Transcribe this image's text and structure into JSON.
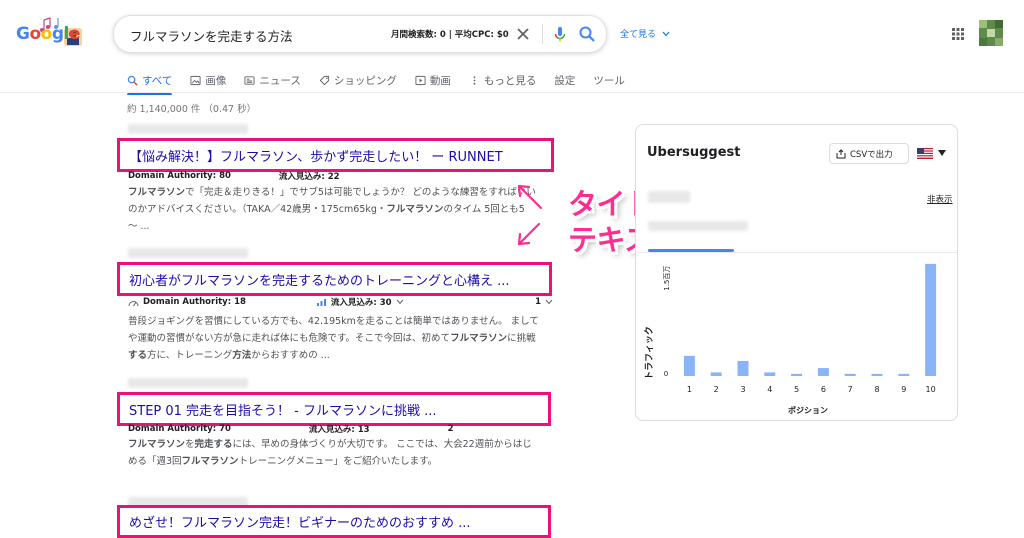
{
  "search": {
    "query": "フルマラソンを完走する方法",
    "stats": "月間検索数: 0 | 平均CPC: $0",
    "see_all": "全て見る"
  },
  "tabs": [
    {
      "label": "すべて",
      "icon": "search-icon",
      "active": true
    },
    {
      "label": "画像",
      "icon": "image-icon"
    },
    {
      "label": "ニュース",
      "icon": "news-icon"
    },
    {
      "label": "ショッピング",
      "icon": "tag-icon"
    },
    {
      "label": "動画",
      "icon": "play-icon"
    },
    {
      "label": "もっと見る",
      "icon": "more-vert-icon"
    },
    {
      "label": "設定"
    },
    {
      "label": "ツール"
    }
  ],
  "result_count": "約 1,140,000 件 （0.47 秒）",
  "results": [
    {
      "title": "【悩み解決！】フルマラソン、歩かず完走したい！ ー RUNNET",
      "meta_da": "Domain Authority: 80",
      "meta_traffic": "流入見込み: 22",
      "snippet_html": "<b>フルマラソン</b>で「完走＆走りきる！」でサブ5は可能でしょうか？ どのような練習をすればいい<br>のかアドバイスください。（TAKA／42歳男・175cm65kg・<b>フルマラソン</b>のタイム 5回とも5<br>〜 ..."
    },
    {
      "title": "初心者がフルマラソンを完走するためのトレーニングと心構え ...",
      "meta_da": "Domain Authority: 18",
      "meta_traffic": "流入見込み: 30",
      "meta_count": "1",
      "snippet_html": "普段ジョギングを習慣にしている方でも、42.195kmを走ることは簡単ではありません。 まして<br>や運動の習慣がない方が急に走れば体にも危険です。そこで今回は、初めて<b>フルマラソン</b>に挑戦<br><b>する</b>方に、トレーニング<b>方法</b>からおすすめの ..."
    },
    {
      "title": "STEP 01 完走を目指そう！ - フルマラソンに挑戦 ...",
      "meta_da": "Domain Authority: 70",
      "meta_traffic": "流入見込み: 13",
      "meta_count": "2",
      "snippet_html": "<b>フルマラソン</b>を<b>完走する</b>には、早めの身体づくりが大切です。 ここでは、大会22週前からはじ<br>める「週3回<b>フルマラソン</b>トレーニングメニュー」をご紹介いたします。"
    },
    {
      "title": "めざせ！フルマラソン完走！ビギナーのためのおすすめ ..."
    }
  ],
  "annotation": {
    "line1": "タイトルタグで入力した",
    "line2": "テキストが表示される"
  },
  "panel": {
    "title": "Ubersuggest",
    "csv_label": "CSVで出力",
    "hide_label": "非表示",
    "colors": {
      "bar": "#8ab4f8",
      "accent": "#4285f4",
      "annotation": "#ff2d8f",
      "box": "#e8127a"
    }
  },
  "chart_data": {
    "type": "bar",
    "categories": [
      "1",
      "2",
      "3",
      "4",
      "5",
      "6",
      "7",
      "8",
      "9",
      "10"
    ],
    "values": [
      0.28,
      0.05,
      0.21,
      0.05,
      0.03,
      0.11,
      0.03,
      0.03,
      0.03,
      1.56
    ],
    "xlabel": "ポジション",
    "ylabel": "トラフィック",
    "ylim": [
      0,
      1.6
    ],
    "y_ticks": [
      {
        "value": 0,
        "label": "0"
      },
      {
        "value": 1.5,
        "label": "1.5百万"
      }
    ],
    "grid": false,
    "legend": "none"
  }
}
